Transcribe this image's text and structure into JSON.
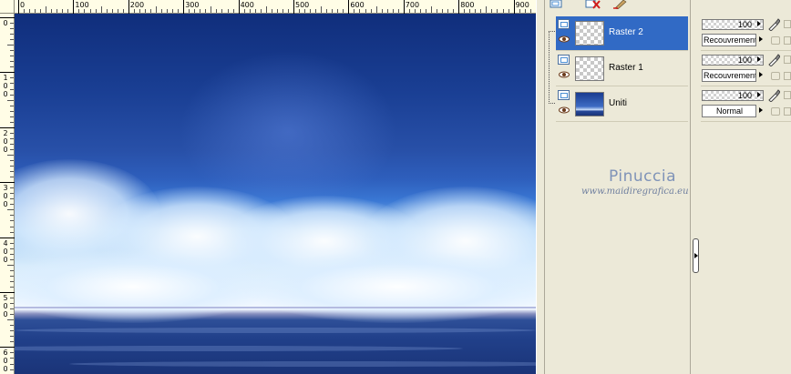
{
  "ruler": {
    "top_labels": [
      "0",
      "100",
      "200",
      "300",
      "400",
      "500",
      "600",
      "700",
      "800",
      "900"
    ],
    "left_labels": [
      [
        "0"
      ],
      [
        "1",
        "0",
        "0"
      ],
      [
        "2",
        "0",
        "0"
      ],
      [
        "3",
        "0",
        "0"
      ],
      [
        "4",
        "0",
        "0"
      ],
      [
        "5",
        "0",
        "0"
      ],
      [
        "6",
        "0",
        "0"
      ]
    ]
  },
  "toolbar": {
    "icons": [
      "new-layer-icon",
      "delete-layer-icon",
      "edit-icon"
    ]
  },
  "layers": [
    {
      "name": "Raster 2",
      "selected": true,
      "thumb": "transparent",
      "opacity": "100",
      "blend": "Recouvrement"
    },
    {
      "name": "Raster 1",
      "selected": false,
      "thumb": "transparent",
      "opacity": "100",
      "blend": "Recouvrement"
    },
    {
      "name": "Uniti",
      "selected": false,
      "thumb": "image",
      "opacity": "100",
      "blend": "Normal"
    }
  ],
  "watermark": {
    "title": "Pinuccia",
    "url": "www.maidiregrafica.eu"
  }
}
